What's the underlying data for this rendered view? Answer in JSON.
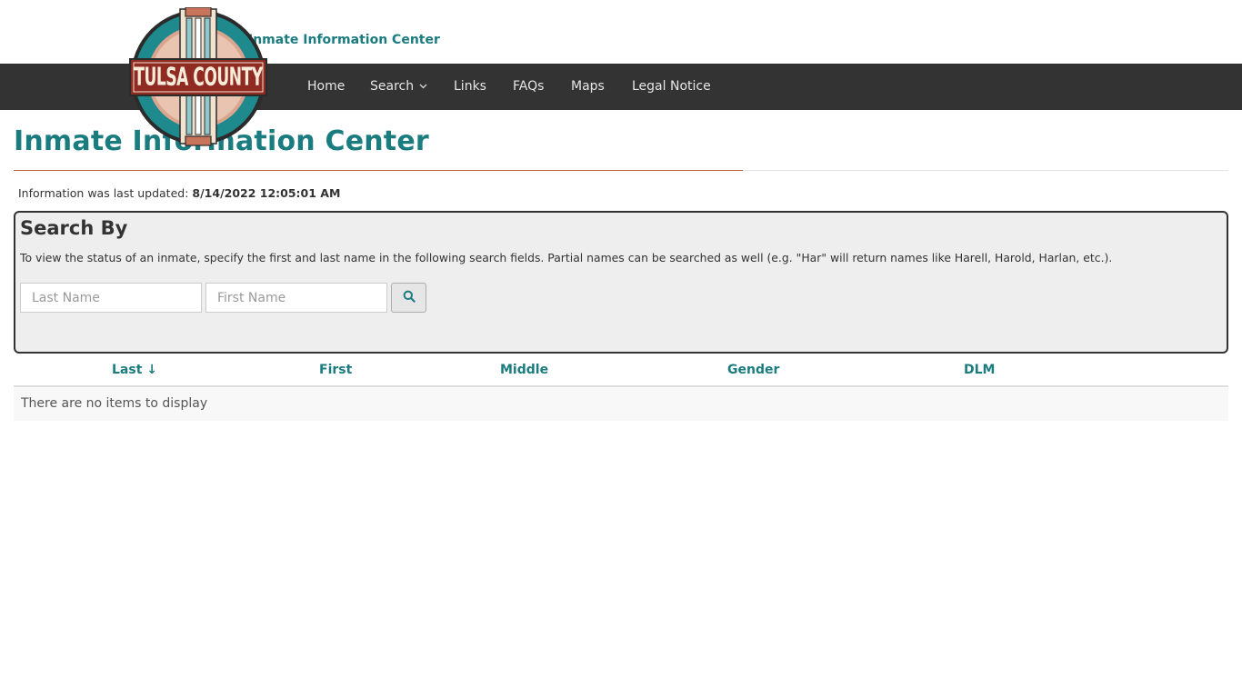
{
  "header": {
    "site_title": "Inmate Information Center",
    "logo_text": "TULSA COUNTY"
  },
  "nav": {
    "items": [
      {
        "label": "Home"
      },
      {
        "label": "Search",
        "has_dropdown": true
      },
      {
        "label": "Links"
      },
      {
        "label": "FAQs"
      },
      {
        "label": "Maps"
      },
      {
        "label": "Legal Notice"
      }
    ]
  },
  "main": {
    "title": "Inmate Information Center",
    "updated_label": "Information was last updated:",
    "updated_value": "8/14/2022 12:05:01 AM"
  },
  "search": {
    "heading": "Search By",
    "help_text": "To view the status of an inmate, specify the first and last name in the following search fields. Partial names can be searched as well (e.g. \"Har\" will return names like Harell, Harold, Harlan, etc.).",
    "last_name_placeholder": "Last Name",
    "first_name_placeholder": "First Name",
    "last_name_value": "",
    "first_name_value": ""
  },
  "results": {
    "columns": [
      {
        "label": "Last ↓"
      },
      {
        "label": "First"
      },
      {
        "label": "Middle"
      },
      {
        "label": "Gender"
      },
      {
        "label": "DLM"
      }
    ],
    "empty_message": "There are no items to display"
  },
  "colors": {
    "accent": "#1b7c80",
    "nav_bg": "#333333",
    "rule_accent": "#b8633b",
    "logo_red": "#8f2b23",
    "logo_teal": "#1e8a8d"
  }
}
